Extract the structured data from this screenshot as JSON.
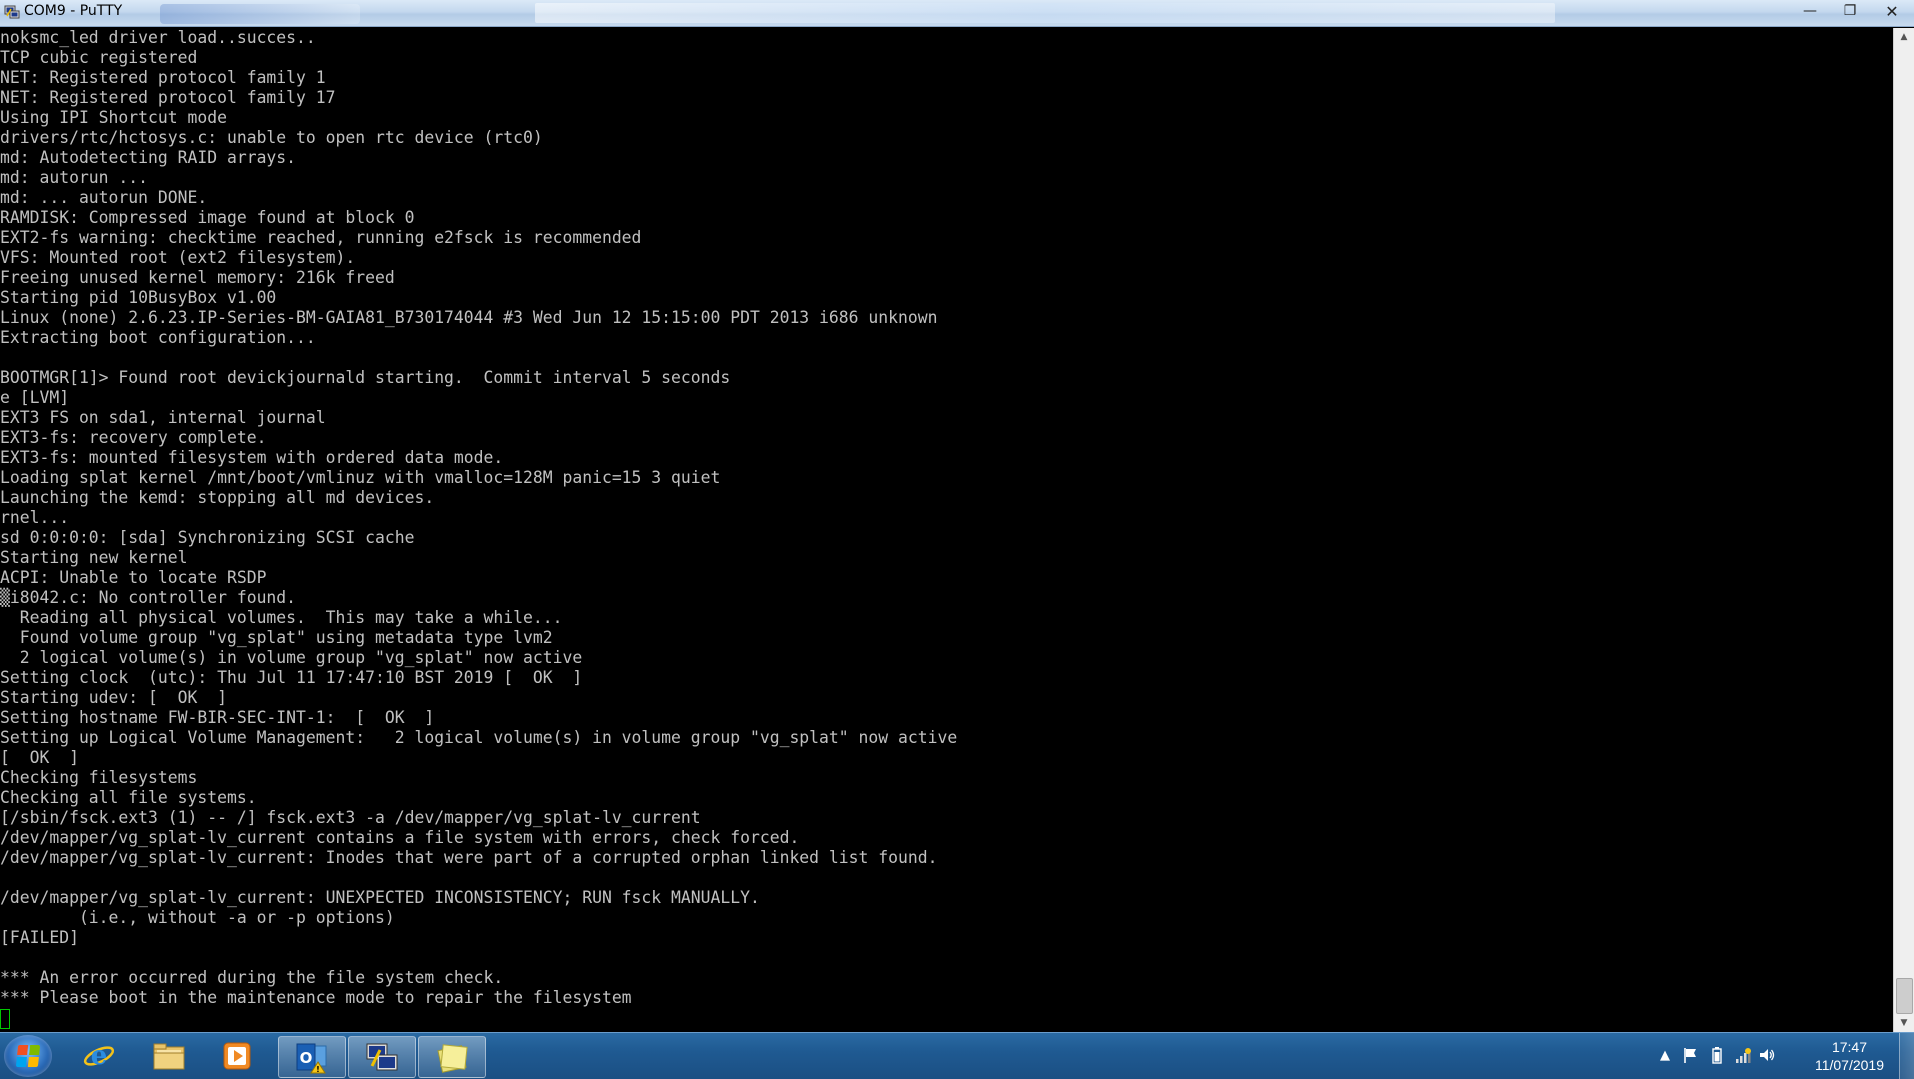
{
  "window": {
    "title": "COM9 - PuTTY",
    "buttons": {
      "minimize": "—",
      "maximize": "❐",
      "close": "✕"
    }
  },
  "terminal": {
    "lines": [
      "noksmc_led driver load..succes..",
      "TCP cubic registered",
      "NET: Registered protocol family 1",
      "NET: Registered protocol family 17",
      "Using IPI Shortcut mode",
      "drivers/rtc/hctosys.c: unable to open rtc device (rtc0)",
      "md: Autodetecting RAID arrays.",
      "md: autorun ...",
      "md: ... autorun DONE.",
      "RAMDISK: Compressed image found at block 0",
      "EXT2-fs warning: checktime reached, running e2fsck is recommended",
      "VFS: Mounted root (ext2 filesystem).",
      "Freeing unused kernel memory: 216k freed",
      "Starting pid 10BusyBox v1.00",
      "Linux (none) 2.6.23.IP-Series-BM-GAIA81_B730174044 #3 Wed Jun 12 15:15:00 PDT 2013 i686 unknown",
      "Extracting boot configuration...",
      "",
      "BOOTMGR[1]> Found root devickjournald starting.  Commit interval 5 seconds",
      "e [LVM]",
      "EXT3 FS on sda1, internal journal",
      "EXT3-fs: recovery complete.",
      "EXT3-fs: mounted filesystem with ordered data mode.",
      "Loading splat kernel /mnt/boot/vmlinuz with vmalloc=128M panic=15 3 quiet",
      "Launching the kemd: stopping all md devices.",
      "rnel...",
      "sd 0:0:0:0: [sda] Synchronizing SCSI cache",
      "Starting new kernel",
      "ACPI: Unable to locate RSDP",
      "▒i8042.c: No controller found.",
      "  Reading all physical volumes.  This may take a while...",
      "  Found volume group \"vg_splat\" using metadata type lvm2",
      "  2 logical volume(s) in volume group \"vg_splat\" now active",
      "Setting clock  (utc): Thu Jul 11 17:47:10 BST 2019 [  OK  ]",
      "Starting udev: [  OK  ]",
      "Setting hostname FW-BIR-SEC-INT-1:  [  OK  ]",
      "Setting up Logical Volume Management:   2 logical volume(s) in volume group \"vg_splat\" now active",
      "[  OK  ]",
      "Checking filesystems",
      "Checking all file systems.",
      "[/sbin/fsck.ext3 (1) -- /] fsck.ext3 -a /dev/mapper/vg_splat-lv_current",
      "/dev/mapper/vg_splat-lv_current contains a file system with errors, check forced.",
      "/dev/mapper/vg_splat-lv_current: Inodes that were part of a corrupted orphan linked list found.",
      "",
      "/dev/mapper/vg_splat-lv_current: UNEXPECTED INCONSISTENCY; RUN fsck MANUALLY.",
      "        (i.e., without -a or -p options)",
      "[FAILED]",
      "",
      "*** An error occurred during the file system check.",
      "*** Please boot in the maintenance mode to repair the filesystem"
    ],
    "text_color": "#c0c0c0",
    "cursor_color": "#00c800"
  },
  "scrollbar": {
    "up_arrow": "▲",
    "down_arrow": "▼"
  },
  "taskbar": {
    "start_icon": "windows-logo-icon",
    "pinned": [
      {
        "name": "internet-explorer-icon"
      },
      {
        "name": "file-explorer-icon"
      },
      {
        "name": "media-player-icon"
      },
      {
        "name": "outlook-icon"
      },
      {
        "name": "putty-icon"
      },
      {
        "name": "sticky-notes-icon"
      }
    ],
    "tray": {
      "show_hidden": "▲",
      "clock_time": "17:47",
      "clock_date": "11/07/2019"
    }
  }
}
